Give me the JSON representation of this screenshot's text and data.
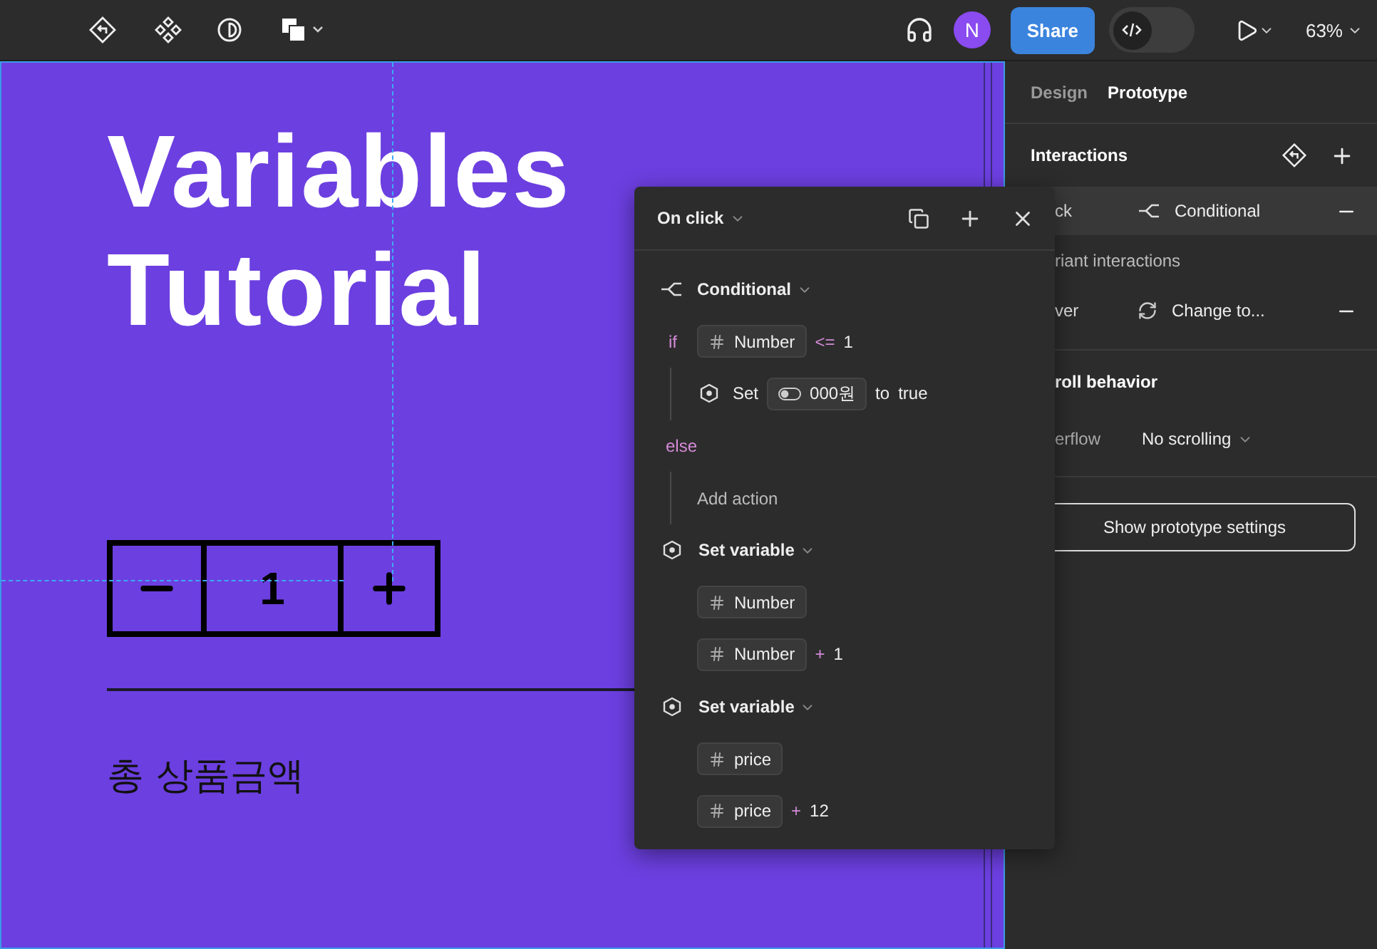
{
  "toolbar": {
    "avatar": "N",
    "share": "Share",
    "zoom": "63%",
    "dev_mode": {
      "on": false
    }
  },
  "canvas": {
    "title_lines": [
      "Variables",
      "Tutorial"
    ],
    "stepper": {
      "value": "1"
    },
    "total_label": "총 상품금액"
  },
  "popup": {
    "trigger": "On click",
    "conditional": {
      "title": "Conditional",
      "if": {
        "keyword": "if",
        "variable": "Number",
        "operator": "<=",
        "value": "1"
      },
      "then": [
        {
          "verb": "Set",
          "variable": "000원",
          "to": "to",
          "value": "true"
        }
      ],
      "else": {
        "keyword": "else",
        "placeholder": "Add action"
      }
    },
    "set_variables": [
      {
        "title": "Set variable",
        "target": "Number",
        "expression": {
          "variable": "Number",
          "operator": "+",
          "value": "1"
        }
      },
      {
        "title": "Set variable",
        "target": "price",
        "expression": {
          "variable": "price",
          "operator": "+",
          "value": "12"
        }
      }
    ]
  },
  "panel": {
    "tabs": [
      {
        "label": "Design",
        "selected": false
      },
      {
        "label": "Prototype",
        "selected": true
      }
    ],
    "interactions_title": "Interactions",
    "interactions": [
      {
        "trigger": "ck",
        "kind": "conditional",
        "action": "Conditional",
        "selected": true
      }
    ],
    "variant_title": "riant interactions",
    "variant_interactions": [
      {
        "trigger": "ver",
        "kind": "change",
        "action": "Change to...",
        "selected": false
      }
    ],
    "scroll_title": "roll behavior",
    "overflow": {
      "label": "erflow",
      "value": "No scrolling"
    },
    "settings_button": "Show prototype settings"
  }
}
